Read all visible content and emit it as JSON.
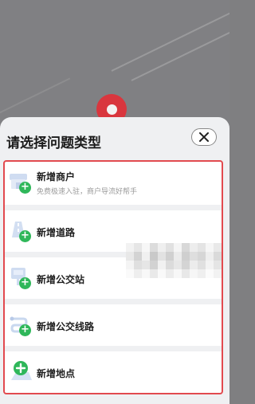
{
  "sheet": {
    "title": "请选择问题类型"
  },
  "options": [
    {
      "label": "新增商户",
      "sublabel": "免费极速入驻，商户导流好帮手",
      "icon": "shop-add-icon"
    },
    {
      "label": "新增道路",
      "sublabel": "",
      "icon": "road-add-icon"
    },
    {
      "label": "新增公交站",
      "sublabel": "",
      "icon": "bus-stop-add-icon"
    },
    {
      "label": "新增公交线路",
      "sublabel": "",
      "icon": "bus-route-add-icon"
    },
    {
      "label": "新增地点",
      "sublabel": "",
      "icon": "location-add-icon"
    }
  ],
  "colors": {
    "highlight": "#e24a4f",
    "pin": "#d9363e",
    "plus": "#2fb75a",
    "icon_blue": "#c9d8ef"
  }
}
